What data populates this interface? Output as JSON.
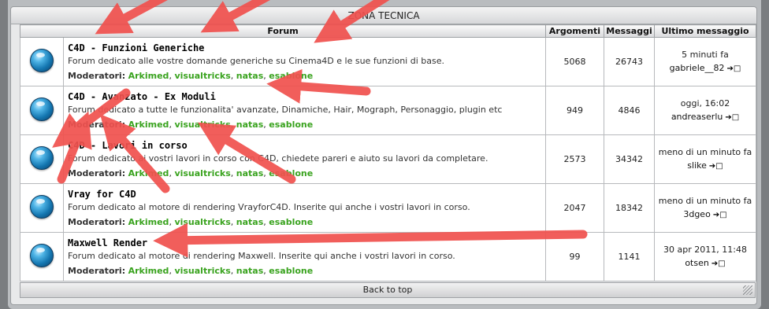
{
  "category": {
    "title": "ZONA TECNICA"
  },
  "columns": {
    "forum": "Forum",
    "topics": "Argomenti",
    "posts": "Messaggi",
    "last": "Ultimo messaggio"
  },
  "moderators_label": "Moderatori:",
  "forums": [
    {
      "title": "C4D - Funzioni Generiche",
      "description": "Forum dedicato alle vostre domande generiche su Cinema4D e le sue funzioni di base.",
      "moderators": [
        "Arkimed",
        "visualtricks",
        "natas",
        "esablone"
      ],
      "topics": "5068",
      "posts": "26743",
      "last_time": "5 minuti fa",
      "last_user": "gabriele__82"
    },
    {
      "title": "C4D - Avanzato - Ex Moduli",
      "description": "Forum dedicato a tutte le funzionalita' avanzate, Dinamiche, Hair, Mograph, Personaggio, plugin etc",
      "moderators": [
        "Arkimed",
        "visualtricks",
        "natas",
        "esablone"
      ],
      "topics": "949",
      "posts": "4846",
      "last_time": "oggi, 16:02",
      "last_user": "andreaserlu"
    },
    {
      "title": "C4D - Lavori in corso",
      "description": "Forum dedicato ai vostri lavori in corso con C4D, chiedete pareri e aiuto su lavori da completare.",
      "moderators": [
        "Arkimed",
        "visualtricks",
        "natas",
        "esablone"
      ],
      "topics": "2573",
      "posts": "34342",
      "last_time": "meno di un minuto fa",
      "last_user": "slike"
    },
    {
      "title": "Vray for C4D",
      "description": "Forum dedicato al motore di rendering VrayforC4D. Inserite qui anche i vostri lavori in corso.",
      "moderators": [
        "Arkimed",
        "visualtricks",
        "natas",
        "esablone"
      ],
      "topics": "2047",
      "posts": "18342",
      "last_time": "meno di un minuto fa",
      "last_user": "3dgeo"
    },
    {
      "title": "Maxwell Render",
      "description": "Forum dedicato al motore di rendering Maxwell. Inserite qui anche i vostri lavori in corso.",
      "moderators": [
        "Arkimed",
        "visualtricks",
        "natas",
        "esablone"
      ],
      "topics": "99",
      "posts": "1141",
      "last_time": "30 apr 2011, 11:48",
      "last_user": "otsen"
    }
  ],
  "footer": {
    "back_to_top": "Back to top"
  },
  "icons": {
    "forum": "forum-globe-icon",
    "goto": "goto-last-post-icon",
    "resize": "resize-grip-icon"
  },
  "colors": {
    "moderator_link": "#3aa31f",
    "annotation_arrow": "#f0524f"
  }
}
